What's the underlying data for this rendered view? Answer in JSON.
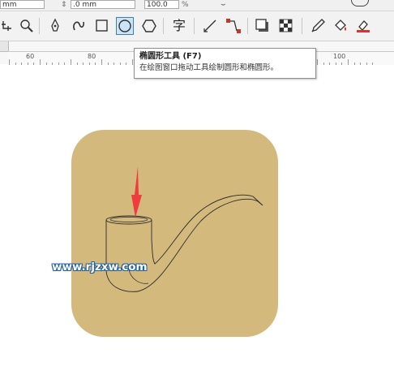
{
  "property_bar": {
    "unit_field": "mm",
    "width_field": ".0 mm",
    "scale_field": "100.0",
    "percent": "%"
  },
  "toolbox": {
    "tools": [
      {
        "name": "crop-tool-icon",
        "active": false
      },
      {
        "name": "zoom-tool-icon",
        "active": false
      },
      {
        "name": "pen-tool-icon",
        "active": false
      },
      {
        "name": "artistic-media-icon",
        "active": false
      },
      {
        "name": "rectangle-tool-icon",
        "active": false
      },
      {
        "name": "ellipse-tool-icon",
        "active": true
      },
      {
        "name": "polygon-tool-icon",
        "active": false
      },
      {
        "name": "text-tool-icon",
        "glyph": "字",
        "active": false
      },
      {
        "name": "parallel-dimension-icon",
        "active": false
      },
      {
        "name": "connector-tool-icon",
        "active": false
      },
      {
        "name": "drop-shadow-icon",
        "active": false
      },
      {
        "name": "transparency-icon",
        "active": false
      },
      {
        "name": "eyedropper-icon",
        "active": false
      },
      {
        "name": "fill-bucket-icon",
        "active": false
      },
      {
        "name": "smart-fill-icon",
        "active": false
      }
    ]
  },
  "ruler": {
    "labels": [
      "60",
      "80",
      "100"
    ]
  },
  "tooltip": {
    "title": "椭圆形工具 (F7)",
    "description": "在绘图窗口拖动工具绘制圆形和椭圆形。"
  },
  "canvas": {
    "tile_color": "#d4b97d",
    "arrow_color": "#f03c3c",
    "watermark": "www.rjzxw.com"
  }
}
